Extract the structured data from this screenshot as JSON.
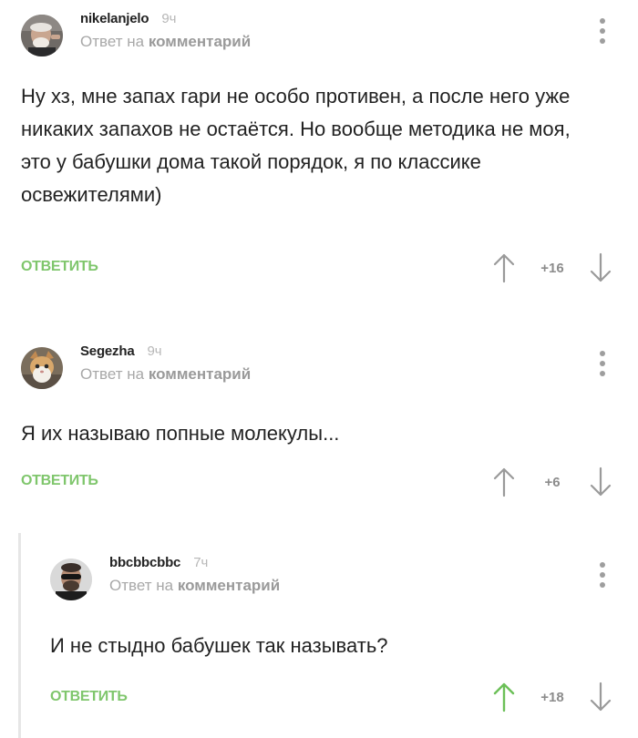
{
  "comments": [
    {
      "username": "nikelanjelo",
      "time": "9ч",
      "reply_prefix": "Ответ на",
      "reply_link": "комментарий",
      "text": "Ну хз, мне запах гари не особо противен, а после него уже никаких запахов не остаётся. Но вообще методика не моя, это у бабушки дома такой порядок, я по классике освежителями)",
      "reply_label": "ОТВЕТИТЬ",
      "score": "+16",
      "upvoted": false
    },
    {
      "username": "Segezha",
      "time": "9ч",
      "reply_prefix": "Ответ на",
      "reply_link": "комментарий",
      "text": "Я их называю попные молекулы...",
      "reply_label": "ОТВЕТИТЬ",
      "score": "+6",
      "upvoted": false
    },
    {
      "username": "bbcbbcbbc",
      "time": "7ч",
      "reply_prefix": "Ответ на",
      "reply_link": "комментарий",
      "text": "И не стыдно бабушек так называть?",
      "reply_label": "ОТВЕТИТЬ",
      "score": "+18",
      "upvoted": true
    }
  ],
  "colors": {
    "accent_green": "#7fc66c",
    "upvote_active": "#6cc058",
    "arrow_inactive": "#9a9a9a",
    "meta_gray": "#a8a8a8"
  },
  "icons": [
    "avatar-old-man",
    "avatar-cat",
    "avatar-man-sunglasses",
    "more-vertical-icon",
    "arrow-up-icon",
    "arrow-down-icon"
  ]
}
